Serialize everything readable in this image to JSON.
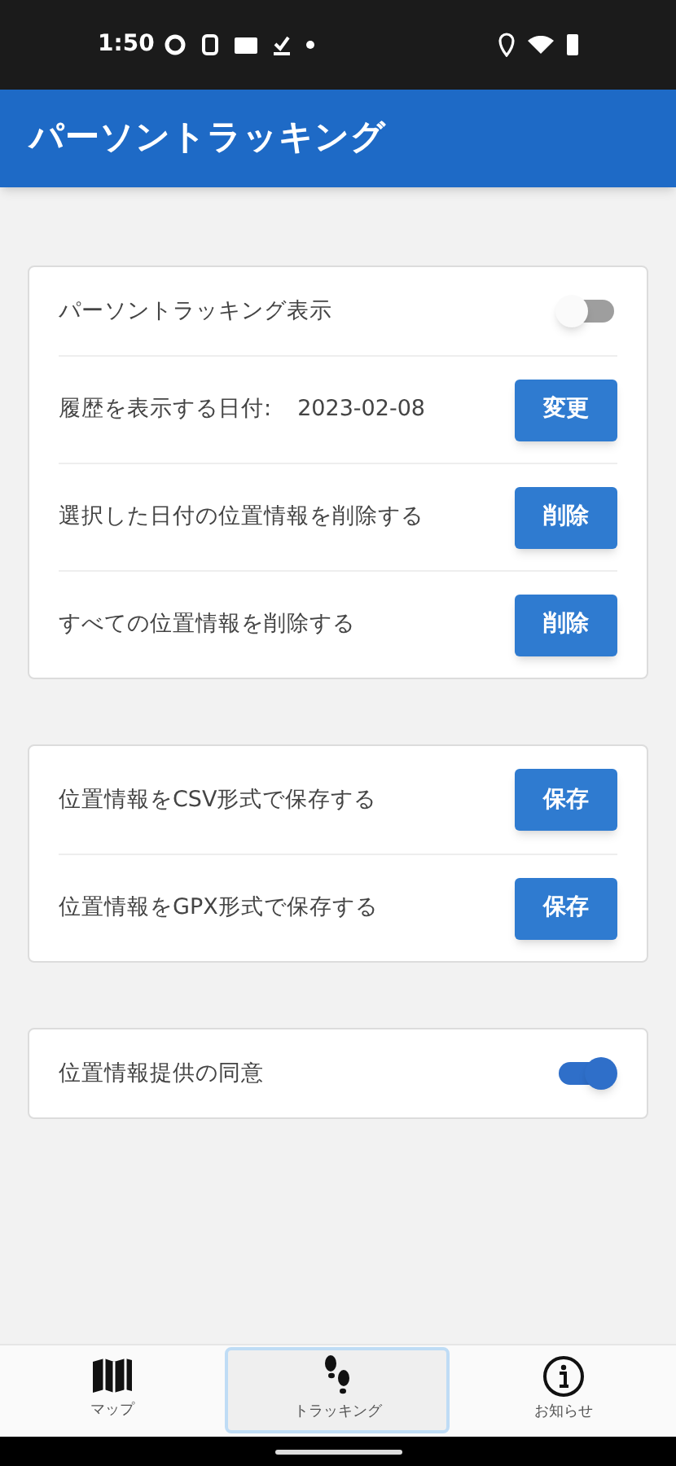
{
  "status_bar": {
    "time": "1:50"
  },
  "app_bar": {
    "title": "パーソントラッキング"
  },
  "sections": [
    {
      "rows": [
        {
          "kind": "toggle",
          "label": "パーソントラッキング表示",
          "on": false
        },
        {
          "kind": "button",
          "label": "履歴を表示する日付:",
          "value": "2023-02-08",
          "button": "変更"
        },
        {
          "kind": "button",
          "label": "選択した日付の位置情報を削除する",
          "button": "削除"
        },
        {
          "kind": "button",
          "label": "すべての位置情報を削除する",
          "button": "削除"
        }
      ]
    },
    {
      "rows": [
        {
          "kind": "button",
          "label": "位置情報をCSV形式で保存する",
          "button": "保存"
        },
        {
          "kind": "button",
          "label": "位置情報をGPX形式で保存する",
          "button": "保存"
        }
      ]
    },
    {
      "rows": [
        {
          "kind": "toggle",
          "label": "位置情報提供の同意",
          "on": true
        }
      ]
    }
  ],
  "bottom_nav": [
    {
      "kind": "map",
      "label": "マップ",
      "selected": false
    },
    {
      "kind": "steps",
      "label": "トラッキング",
      "selected": true
    },
    {
      "kind": "info",
      "label": "お知らせ",
      "selected": false
    }
  ]
}
